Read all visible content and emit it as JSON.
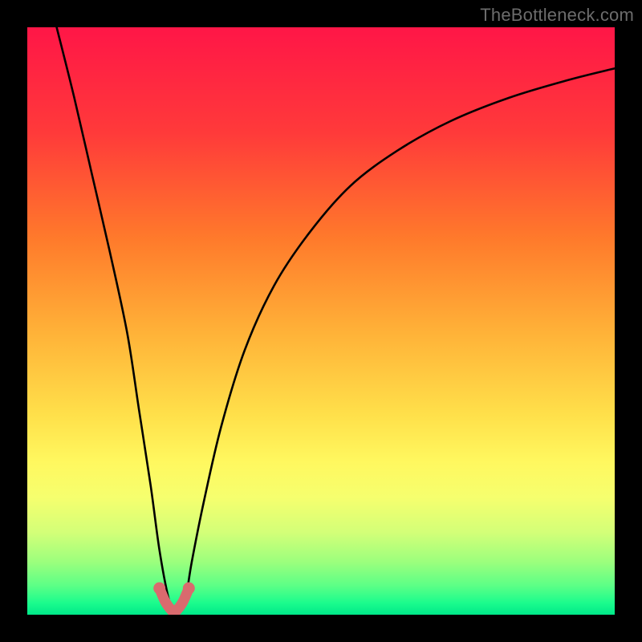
{
  "watermark": "TheBottleneck.com",
  "gradient_stops": [
    {
      "pct": 0,
      "color": "#ff1647"
    },
    {
      "pct": 18,
      "color": "#ff3a3a"
    },
    {
      "pct": 36,
      "color": "#ff7a2b"
    },
    {
      "pct": 52,
      "color": "#ffb238"
    },
    {
      "pct": 66,
      "color": "#ffe04a"
    },
    {
      "pct": 74,
      "color": "#fff85f"
    },
    {
      "pct": 80,
      "color": "#f6ff6e"
    },
    {
      "pct": 86,
      "color": "#d3ff78"
    },
    {
      "pct": 91,
      "color": "#9cff7d"
    },
    {
      "pct": 95,
      "color": "#5dff86"
    },
    {
      "pct": 98,
      "color": "#1bfc8d"
    },
    {
      "pct": 100,
      "color": "#00e889"
    }
  ],
  "chart_data": {
    "type": "line",
    "title": "",
    "xlabel": "",
    "ylabel": "",
    "xlim": [
      0,
      100
    ],
    "ylim": [
      0,
      100
    ],
    "grid": false,
    "legend": false,
    "background": "rainbow-gradient",
    "series": [
      {
        "name": "bottleneck-curve",
        "note": "Absolute-difference-style curve with sharp minimum; y read from vertical position (0 = bottom, 100 = top).",
        "x": [
          5,
          8,
          11,
          14,
          17,
          19,
          21,
          22.5,
          24,
          25,
          26,
          27,
          28,
          30,
          33,
          37,
          42,
          48,
          55,
          63,
          72,
          82,
          92,
          100
        ],
        "y": [
          100,
          88,
          75,
          62,
          48,
          35,
          22,
          11,
          3,
          0.5,
          0.5,
          3,
          9,
          19,
          32,
          45,
          56,
          65,
          73,
          79,
          84,
          88,
          91,
          93
        ]
      },
      {
        "name": "highlight-segment",
        "note": "Thick salmon highlight around the minimum.",
        "x": [
          22.5,
          23.5,
          24.5,
          25,
          25.5,
          26.5,
          27.5
        ],
        "y": [
          4.5,
          2.2,
          0.8,
          0.4,
          0.8,
          2.2,
          4.5
        ]
      }
    ],
    "minimum": {
      "x": 25,
      "y": 0.4
    }
  }
}
